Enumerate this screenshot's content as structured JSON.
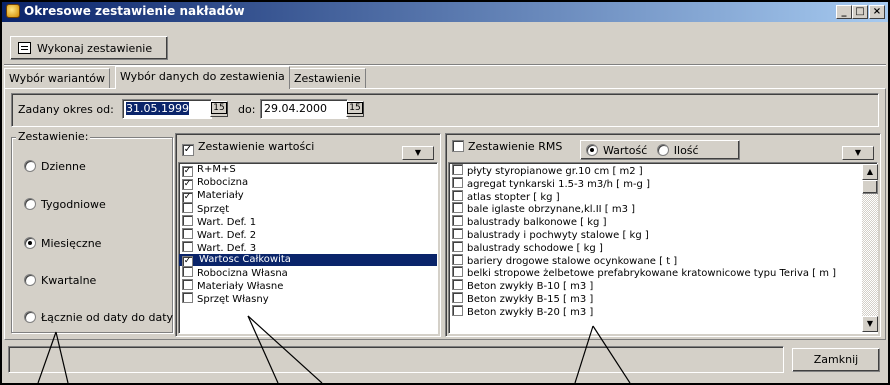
{
  "window": {
    "title": "Okresowe zestawienie nakładów",
    "controls": [
      "_",
      "□",
      "×"
    ]
  },
  "toolbar": {
    "run_label": "Wykonaj zestawienie"
  },
  "tabs": [
    {
      "label": "Wybór wariantów",
      "active": false
    },
    {
      "label": "Wybór danych do zestawienia",
      "active": true
    },
    {
      "label": "Zestawienie",
      "active": false
    }
  ],
  "period": {
    "label_from": "Zadany okres od:",
    "from_value": "31.05.1999",
    "label_to": "do:",
    "to_value": "29.04.2000",
    "calendar_icon": "15"
  },
  "zestawienie": {
    "group_label": "Zestawienie:",
    "options": [
      {
        "label": "Dzienne",
        "selected": false
      },
      {
        "label": "Tygodniowe",
        "selected": false
      },
      {
        "label": "Miesięczne",
        "selected": true
      },
      {
        "label": "Kwartalne",
        "selected": false
      },
      {
        "label": "Łącznie od daty do daty",
        "selected": false
      }
    ]
  },
  "wartosci_panel": {
    "header": "Zestawienie wartości",
    "checked": true,
    "items": [
      {
        "label": "R+M+S",
        "checked": true
      },
      {
        "label": "Robocizna",
        "checked": true
      },
      {
        "label": "Materiały",
        "checked": true
      },
      {
        "label": "Sprzęt",
        "checked": false
      },
      {
        "label": "Wart. Def. 1",
        "checked": false
      },
      {
        "label": "Wart. Def. 2",
        "checked": false
      },
      {
        "label": "Wart. Def. 3",
        "checked": false
      },
      {
        "label": "Wartosc Całkowita",
        "checked": true,
        "highlighted": true
      },
      {
        "label": "Robocizna Własna",
        "checked": false
      },
      {
        "label": "Materiały Własne",
        "checked": false
      },
      {
        "label": "Sprzęt Własny",
        "checked": false
      }
    ]
  },
  "rms_panel": {
    "header": "Zestawienie RMS",
    "checked": false,
    "mode_value": "Wartość",
    "mode_qty": "Ilość",
    "mode_selected": "Wartość",
    "items": [
      "płyty styropianowe gr.10 cm [ m2 ]",
      "agregat tynkarski 1.5-3 m3/h [ m-g ]",
      "atlas stopter [ kg ]",
      "bale iglaste obrzynane,kl.II [ m3 ]",
      "balustrady balkonowe [ kg ]",
      "balustrady i pochwyty stalowe [ kg ]",
      "balustrady schodowe [ kg ]",
      "bariery drogowe stalowe ocynkowane [ t ]",
      "belki stropowe żelbetowe prefabrykowane kratownicowe typu Teriva [ m ]",
      "Beton zwykły B-10 [ m3 ]",
      "Beton zwykły B-15 [ m3 ]",
      "Beton zwykły B-20 [ m3 ]"
    ]
  },
  "footer": {
    "close_label": "Zamknij"
  }
}
